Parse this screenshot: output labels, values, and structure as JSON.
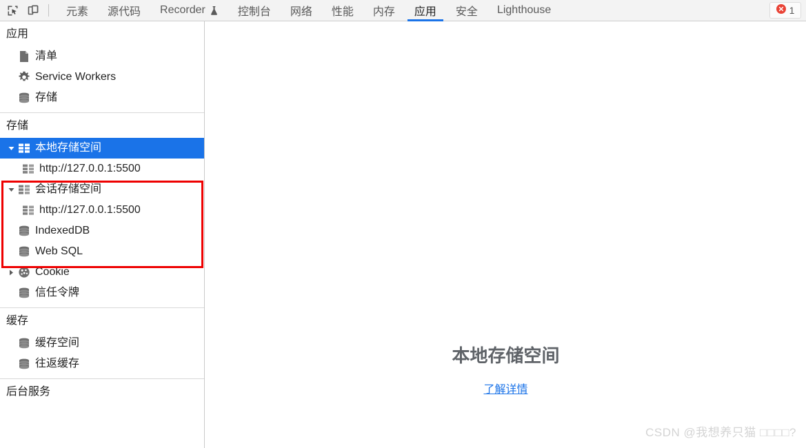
{
  "toolbar": {
    "icons": [
      {
        "name": "inspect-element-icon",
        "label": "检查元素"
      },
      {
        "name": "device-toolbar-icon",
        "label": "切换设备工具栏"
      }
    ],
    "tabs": [
      {
        "label": "元素",
        "active": false,
        "icon": ""
      },
      {
        "label": "源代码",
        "active": false,
        "icon": ""
      },
      {
        "label": "Recorder",
        "active": false,
        "icon": "flask-icon"
      },
      {
        "label": "控制台",
        "active": false,
        "icon": ""
      },
      {
        "label": "网络",
        "active": false,
        "icon": ""
      },
      {
        "label": "性能",
        "active": false,
        "icon": ""
      },
      {
        "label": "内存",
        "active": false,
        "icon": ""
      },
      {
        "label": "应用",
        "active": true,
        "icon": ""
      },
      {
        "label": "安全",
        "active": false,
        "icon": ""
      },
      {
        "label": "Lighthouse",
        "active": false,
        "icon": ""
      }
    ],
    "error_badge": {
      "icon": "error-circle-icon",
      "count": "1"
    }
  },
  "sidebar": {
    "sections": [
      {
        "title": "应用",
        "items": [
          {
            "label": "清单",
            "icon": "manifest-document-icon",
            "indent": 1,
            "twisty": "none",
            "selected": false
          },
          {
            "label": "Service Workers",
            "icon": "gear-icon",
            "indent": 1,
            "twisty": "none",
            "selected": false
          },
          {
            "label": "存储",
            "icon": "database-icon",
            "indent": 1,
            "twisty": "none",
            "selected": false
          }
        ]
      },
      {
        "title": "存储",
        "items": [
          {
            "label": "本地存储空间",
            "icon": "table-grid-icon",
            "indent": 1,
            "twisty": "expanded",
            "selected": true
          },
          {
            "label": "http://127.0.0.1:5500",
            "icon": "table-grid-icon",
            "indent": 2,
            "twisty": "none",
            "selected": false
          },
          {
            "label": "会话存储空间",
            "icon": "table-grid-icon",
            "indent": 1,
            "twisty": "expanded",
            "selected": false
          },
          {
            "label": "http://127.0.0.1:5500",
            "icon": "table-grid-icon",
            "indent": 2,
            "twisty": "none",
            "selected": false
          },
          {
            "label": "IndexedDB",
            "icon": "database-icon",
            "indent": 1,
            "twisty": "none",
            "selected": false
          },
          {
            "label": "Web SQL",
            "icon": "database-icon",
            "indent": 1,
            "twisty": "none",
            "selected": false
          },
          {
            "label": "Cookie",
            "icon": "cookie-icon",
            "indent": 1,
            "twisty": "collapsed",
            "selected": false
          },
          {
            "label": "信任令牌",
            "icon": "database-icon",
            "indent": 1,
            "twisty": "none",
            "selected": false
          }
        ]
      },
      {
        "title": "缓存",
        "items": [
          {
            "label": "缓存空间",
            "icon": "database-icon",
            "indent": 1,
            "twisty": "none",
            "selected": false
          },
          {
            "label": "往返缓存",
            "icon": "database-icon",
            "indent": 1,
            "twisty": "none",
            "selected": false
          }
        ]
      },
      {
        "title": "后台服务",
        "items": []
      }
    ]
  },
  "main": {
    "empty_state_title": "本地存储空间",
    "empty_state_link": "了解详情"
  },
  "annotation": {
    "name": "red-highlight-rectangle",
    "color": "#ee0000"
  },
  "watermark": "CSDN @我想养只猫 □□□□?",
  "colors": {
    "selection_blue": "#1a73e8",
    "link_blue": "#1a73e8",
    "annotation_red": "#ee0000",
    "toolbar_bg": "#f3f3f3",
    "error_red": "#e94235"
  }
}
